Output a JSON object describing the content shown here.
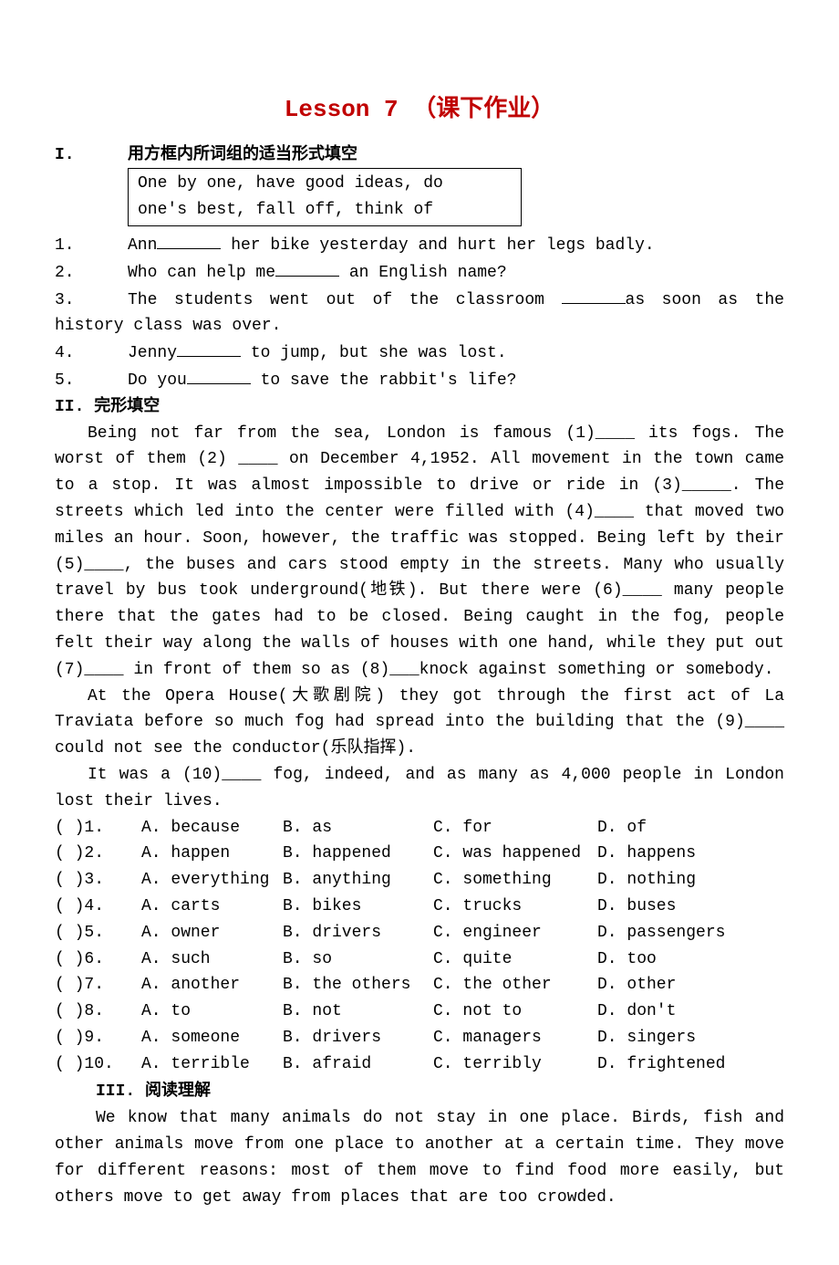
{
  "title": "Lesson 7 （课下作业）",
  "section1": {
    "num": "I.",
    "head": "用方框内所词组的适当形式填空",
    "box": [
      "One by one, have good ideas, do",
      "one's best, fall off, think of"
    ],
    "q1_a": "1.",
    "q1_b": "Ann",
    "q1_c": " her bike yesterday and hurt her legs badly.",
    "q2_a": "2.",
    "q2_b": "Who can help me",
    "q2_c": " an English name?",
    "q3_a": "3.",
    "q3_b": "The students went out of the classroom ",
    "q3_c": "as soon as the history class was over.",
    "q4_a": "4.",
    "q4_b": "Jenny",
    "q4_c": " to jump, but she was lost.",
    "q5_a": "5.",
    "q5_b": "Do you",
    "q5_c": " to save the rabbit's life?"
  },
  "section2": {
    "num": "II.",
    "head": "完形填空",
    "p1": "Being not far from the sea, London is famous (1)____ its fogs. The worst of them (2) ____ on December 4,1952. All movement in the town came to a stop. It was almost impossible to drive or ride in (3)_____. The streets which led into the center were filled with (4)____ that moved two miles an hour. Soon, however, the traffic was stopped. Being left by their (5)____, the buses and cars stood empty in the streets. Many who usually travel by bus took underground(地铁). But there were (6)____ many people there that the gates had to be closed. Being caught in the fog, people felt their way along the walls of houses with one hand, while they put out (7)____ in front of them so as (8)___knock against something or somebody.",
    "p2": "At the Opera House(大歌剧院) they got through the first act of La Traviata before so much fog had spread into the building that the (9)____ could not see the conductor(乐队指挥).",
    "p3": "It was a (10)____ fog, indeed, and as many as 4,000 people in London lost their lives.",
    "opts": [
      {
        "n": "( )1.",
        "a": "A. because",
        "b": "B. as",
        "c": "C. for",
        "d": "D. of"
      },
      {
        "n": "( )2.",
        "a": "A. happen",
        "b": "B. happened",
        "c": "C. was happened",
        "d": "D. happens"
      },
      {
        "n": "( )3.",
        "a": "A. everything",
        "b": "B. anything",
        "c": "C. something",
        "d": "D. nothing"
      },
      {
        "n": "( )4.",
        "a": "A. carts",
        "b": "B. bikes",
        "c": "C. trucks",
        "d": "D. buses"
      },
      {
        "n": "( )5.",
        "a": "A. owner",
        "b": "B. drivers",
        "c": "C. engineer",
        "d": "D. passengers"
      },
      {
        "n": "( )6.",
        "a": "A. such",
        "b": "B. so",
        "c": "C. quite",
        "d": "D. too"
      },
      {
        "n": "( )7.",
        "a": "A. another",
        "b": "B. the others",
        "c": "C. the other",
        "d": "D. other"
      },
      {
        "n": "( )8.",
        "a": "A. to",
        "b": "B. not",
        "c": "C. not to",
        "d": "D. don't"
      },
      {
        "n": "( )9.",
        "a": "A. someone",
        "b": "B. drivers",
        "c": "C. managers",
        "d": "D. singers"
      },
      {
        "n": "( )10.",
        "a": "A. terrible",
        "b": "B. afraid",
        "c": "C. terribly",
        "d": "D. frightened"
      }
    ]
  },
  "section3": {
    "head": "III. 阅读理解",
    "p1": "We know that many animals do not stay in one place. Birds, fish and other animals move from one place to another at a certain time. They move for different reasons: most of them move to find food more easily, but others move to get away from places that are too crowded."
  }
}
